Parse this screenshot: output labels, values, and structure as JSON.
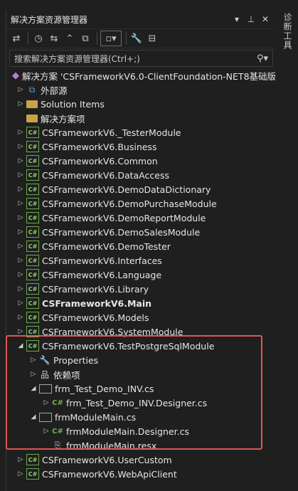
{
  "window": {
    "title": "解决方案资源管理器",
    "pin_icon": "pin-icon",
    "close_icon": "close-icon",
    "dropdown_icon": "chevron-down-icon"
  },
  "side_tab": {
    "label": "诊断工具"
  },
  "search": {
    "placeholder": "搜索解决方案资源管理器(Ctrl+;)"
  },
  "colors": {
    "background": "#1f1f1f",
    "highlight_border": "#e05555",
    "cs_green": "#6aa84f"
  },
  "tree": [
    {
      "label": "解决方案 'CSFrameworkV6.0-ClientFoundation-NET8基础版' (",
      "icon": "solution-icon",
      "arrow": "",
      "indent": 0
    },
    {
      "label": "外部源",
      "icon": "external-sources-icon",
      "arrow": "▷",
      "indent": 1
    },
    {
      "label": "Solution Items",
      "icon": "folder-icon",
      "arrow": "▷",
      "indent": 1
    },
    {
      "label": "解决方案项",
      "icon": "folder-icon",
      "arrow": "",
      "indent": 1
    },
    {
      "label": "CSFrameworkV6._TesterModule",
      "icon": "csharp-project-icon",
      "arrow": "▷",
      "indent": 1
    },
    {
      "label": "CSFrameworkV6.Business",
      "icon": "csharp-project-icon",
      "arrow": "▷",
      "indent": 1
    },
    {
      "label": "CSFrameworkV6.Common",
      "icon": "csharp-project-icon",
      "arrow": "▷",
      "indent": 1
    },
    {
      "label": "CSFrameworkV6.DataAccess",
      "icon": "csharp-project-icon",
      "arrow": "▷",
      "indent": 1
    },
    {
      "label": "CSFrameworkV6.DemoDataDictionary",
      "icon": "csharp-project-icon",
      "arrow": "▷",
      "indent": 1
    },
    {
      "label": "CSFrameworkV6.DemoPurchaseModule",
      "icon": "csharp-project-icon",
      "arrow": "▷",
      "indent": 1
    },
    {
      "label": "CSFrameworkV6.DemoReportModule",
      "icon": "csharp-project-icon",
      "arrow": "▷",
      "indent": 1
    },
    {
      "label": "CSFrameworkV6.DemoSalesModule",
      "icon": "csharp-project-icon",
      "arrow": "▷",
      "indent": 1
    },
    {
      "label": "CSFrameworkV6.DemoTester",
      "icon": "csharp-project-icon",
      "arrow": "▷",
      "indent": 1
    },
    {
      "label": "CSFrameworkV6.Interfaces",
      "icon": "csharp-project-icon",
      "arrow": "▷",
      "indent": 1
    },
    {
      "label": "CSFrameworkV6.Language",
      "icon": "csharp-project-icon",
      "arrow": "▷",
      "indent": 1
    },
    {
      "label": "CSFrameworkV6.Library",
      "icon": "csharp-project-icon",
      "arrow": "▷",
      "indent": 1
    },
    {
      "label": "CSFrameworkV6.Main",
      "icon": "csharp-project-icon",
      "arrow": "▷",
      "indent": 1,
      "bold": true
    },
    {
      "label": "CSFrameworkV6.Models",
      "icon": "csharp-project-icon",
      "arrow": "▷",
      "indent": 1
    },
    {
      "label": "CSFrameworkV6.SystemModule",
      "icon": "csharp-project-icon",
      "arrow": "▷",
      "indent": 1
    },
    {
      "label": "CSFrameworkV6.TestPostgreSqlModule",
      "icon": "csharp-project-icon",
      "arrow": "◢",
      "indent": 1
    },
    {
      "label": "Properties",
      "icon": "properties-icon",
      "arrow": "▷",
      "indent": 2
    },
    {
      "label": "依赖项",
      "icon": "dependencies-icon",
      "arrow": "▷",
      "indent": 2
    },
    {
      "label": "frm_Test_Demo_INV.cs",
      "icon": "form-icon",
      "arrow": "◢",
      "indent": 2
    },
    {
      "label": "frm_Test_Demo_INV.Designer.cs",
      "icon": "csharp-file-icon",
      "arrow": "▷",
      "indent": 3
    },
    {
      "label": "frmModuleMain.cs",
      "icon": "form-icon",
      "arrow": "◢",
      "indent": 2
    },
    {
      "label": "frmModuleMain.Designer.cs",
      "icon": "csharp-file-icon",
      "arrow": "▷",
      "indent": 3
    },
    {
      "label": "frmModuleMain.resx",
      "icon": "resx-file-icon",
      "arrow": "",
      "indent": 3
    },
    {
      "label": "CSFrameworkV6.UserCustom",
      "icon": "csharp-project-icon",
      "arrow": "▷",
      "indent": 1
    },
    {
      "label": "CSFrameworkV6.WebApiClient",
      "icon": "csharp-project-icon",
      "arrow": "▷",
      "indent": 1
    }
  ]
}
